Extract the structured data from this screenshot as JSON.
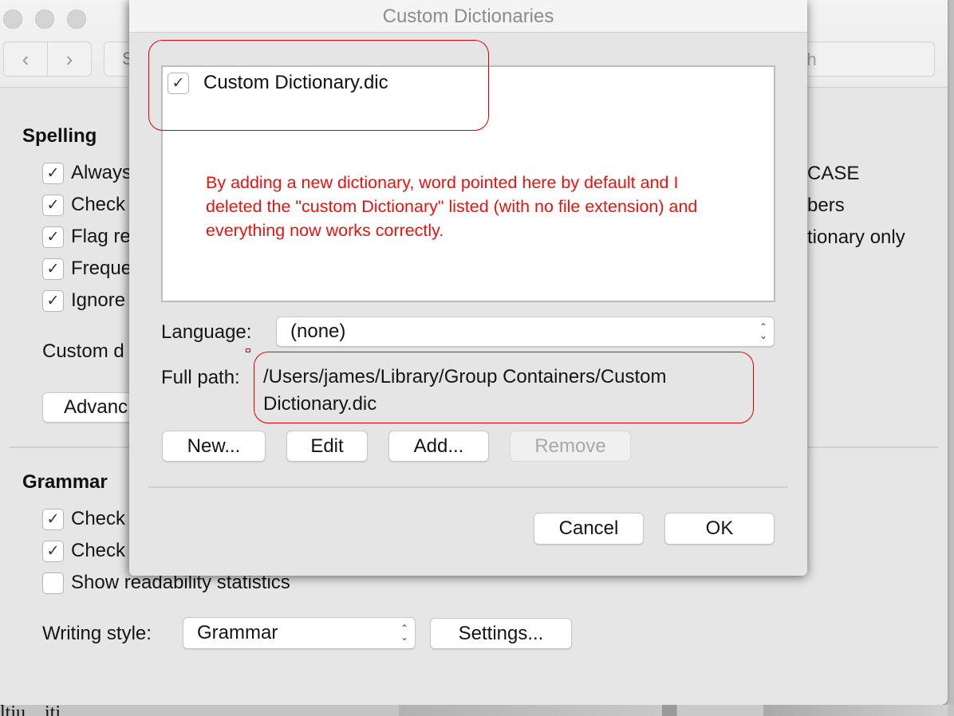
{
  "background_window": {
    "nav": {
      "back_icon": "chevron-left-icon",
      "forward_icon": "chevron-right-icon",
      "back_glyph": "‹",
      "forward_glyph": "›"
    },
    "show_all_partial": "S",
    "search_placeholder_partial": "Search",
    "search_visible_text": "arch",
    "spelling": {
      "title": "Spelling",
      "options": [
        {
          "label": "Always",
          "checked": true
        },
        {
          "label": "Check",
          "checked": true
        },
        {
          "label": "Flag re",
          "checked": true
        },
        {
          "label": "Freque",
          "checked": true
        },
        {
          "label": "Ignore",
          "checked": true
        }
      ],
      "right_column": [
        "CASE",
        "bers",
        "tionary only"
      ],
      "custom_label_partial": "Custom d",
      "advanced_button_partial": "Advanc"
    },
    "grammar": {
      "title": "Grammar",
      "options": [
        {
          "label": "Check",
          "checked": true
        },
        {
          "label": "Check",
          "checked": true
        },
        {
          "label": "Show readability statistics",
          "checked": false
        }
      ],
      "writing_style_label": "Writing style:",
      "writing_style_value": "Grammar",
      "settings_button": "Settings..."
    },
    "stray_bottom_text": "ltiu    ...iti"
  },
  "dialog": {
    "title": "Custom Dictionaries",
    "dictionaries": [
      {
        "name": "Custom Dictionary.dic",
        "checked": true
      }
    ],
    "language_label": "Language:",
    "language_value": "(none)",
    "full_path_label": "Full path:",
    "full_path_value": "/Users/james/Library/Group Containers/Custom Dictionary.dic",
    "buttons": {
      "new": "New...",
      "edit": "Edit",
      "add": "Add...",
      "remove": "Remove"
    },
    "cancel": "Cancel",
    "ok": "OK"
  },
  "annotation": {
    "text": "By adding a new dictionary, word pointed here by default and I deleted the \"custom Dictionary\" listed (with no file extension) and everything now works correctly.",
    "color": "#ee1111"
  },
  "check_glyph": "✓",
  "updown_glyph_up": "⌃",
  "updown_glyph_down": "⌄"
}
